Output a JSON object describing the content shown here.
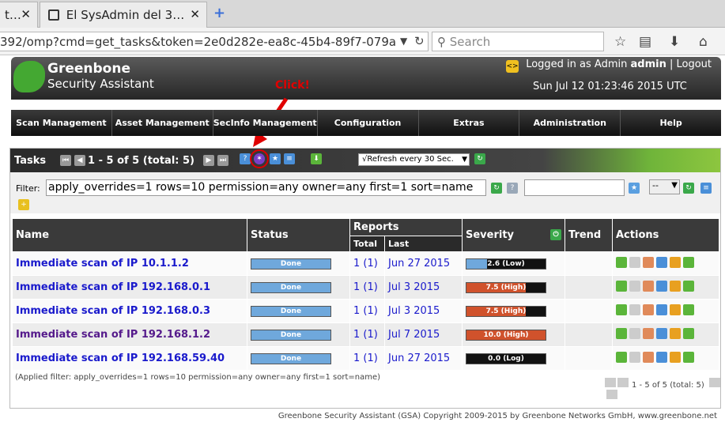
{
  "browser": {
    "tabs": [
      {
        "label": "t…"
      },
      {
        "label": "El SysAdmin del 3…"
      }
    ],
    "new_tab": "+",
    "url": "392/omp?cmd=get_tasks&token=2e0d282e-ea8c-45b4-89f7-079a",
    "search_placeholder": "Search"
  },
  "header": {
    "logo_line1": "Greenbone",
    "logo_line2": "Security Assistant",
    "lang_icon": "<>",
    "login_prefix": "Logged in as Admin",
    "login_user": "admin",
    "logout": "Logout",
    "datetime": "Sun Jul 12 01:23:46 2015 UTC"
  },
  "annotation": {
    "text": "Click!",
    "color": "#e00000"
  },
  "menu": [
    "Scan Management",
    "Asset Management",
    "SecInfo Management",
    "Configuration",
    "Extras",
    "Administration",
    "Help"
  ],
  "tasks_panel": {
    "title": "Tasks",
    "pager": "1 - 5 of 5 (total: 5)",
    "refresh": "√Refresh every 30 Sec.",
    "filter_label": "Filter:",
    "filter_value": "apply_overrides=1 rows=10 permission=any owner=any first=1 sort=name",
    "filter_select": "--",
    "columns": {
      "name": "Name",
      "status": "Status",
      "reports": "Reports",
      "reports_total": "Total",
      "reports_last": "Last",
      "severity": "Severity",
      "trend": "Trend",
      "actions": "Actions"
    },
    "rows": [
      {
        "name": "Immediate scan of IP 10.1.1.2",
        "status": "Done",
        "total": "1 (1)",
        "last": "Jun 27 2015",
        "severity": "2.6 (Low)",
        "score": 2.6,
        "color": "#6fa8dc"
      },
      {
        "name": "Immediate scan of IP 192.168.0.1",
        "status": "Done",
        "total": "1 (1)",
        "last": "Jul 3 2015",
        "severity": "7.5 (High)",
        "score": 7.5,
        "color": "#d0522c"
      },
      {
        "name": "Immediate scan of IP 192.168.0.3",
        "status": "Done",
        "total": "1 (1)",
        "last": "Jul 3 2015",
        "severity": "7.5 (High)",
        "score": 7.5,
        "color": "#d0522c"
      },
      {
        "name": "Immediate scan of IP 192.168.1.2",
        "status": "Done",
        "total": "1 (1)",
        "last": "Jul 7 2015",
        "severity": "10.0 (High)",
        "score": 10.0,
        "color": "#d0522c"
      },
      {
        "name": "Immediate scan of IP 192.168.59.40",
        "status": "Done",
        "total": "1 (1)",
        "last": "Jun 27 2015",
        "severity": "0.0 (Log)",
        "score": 0.0,
        "color": "#111111"
      }
    ],
    "applied_filter": "(Applied filter: apply_overrides=1 rows=10 permission=any owner=any first=1 sort=name)",
    "pager_bottom": "1 - 5 of 5 (total: 5)"
  },
  "footer": "Greenbone Security Assistant (GSA) Copyright 2009-2015 by Greenbone Networks GmbH, www.greenbone.net"
}
